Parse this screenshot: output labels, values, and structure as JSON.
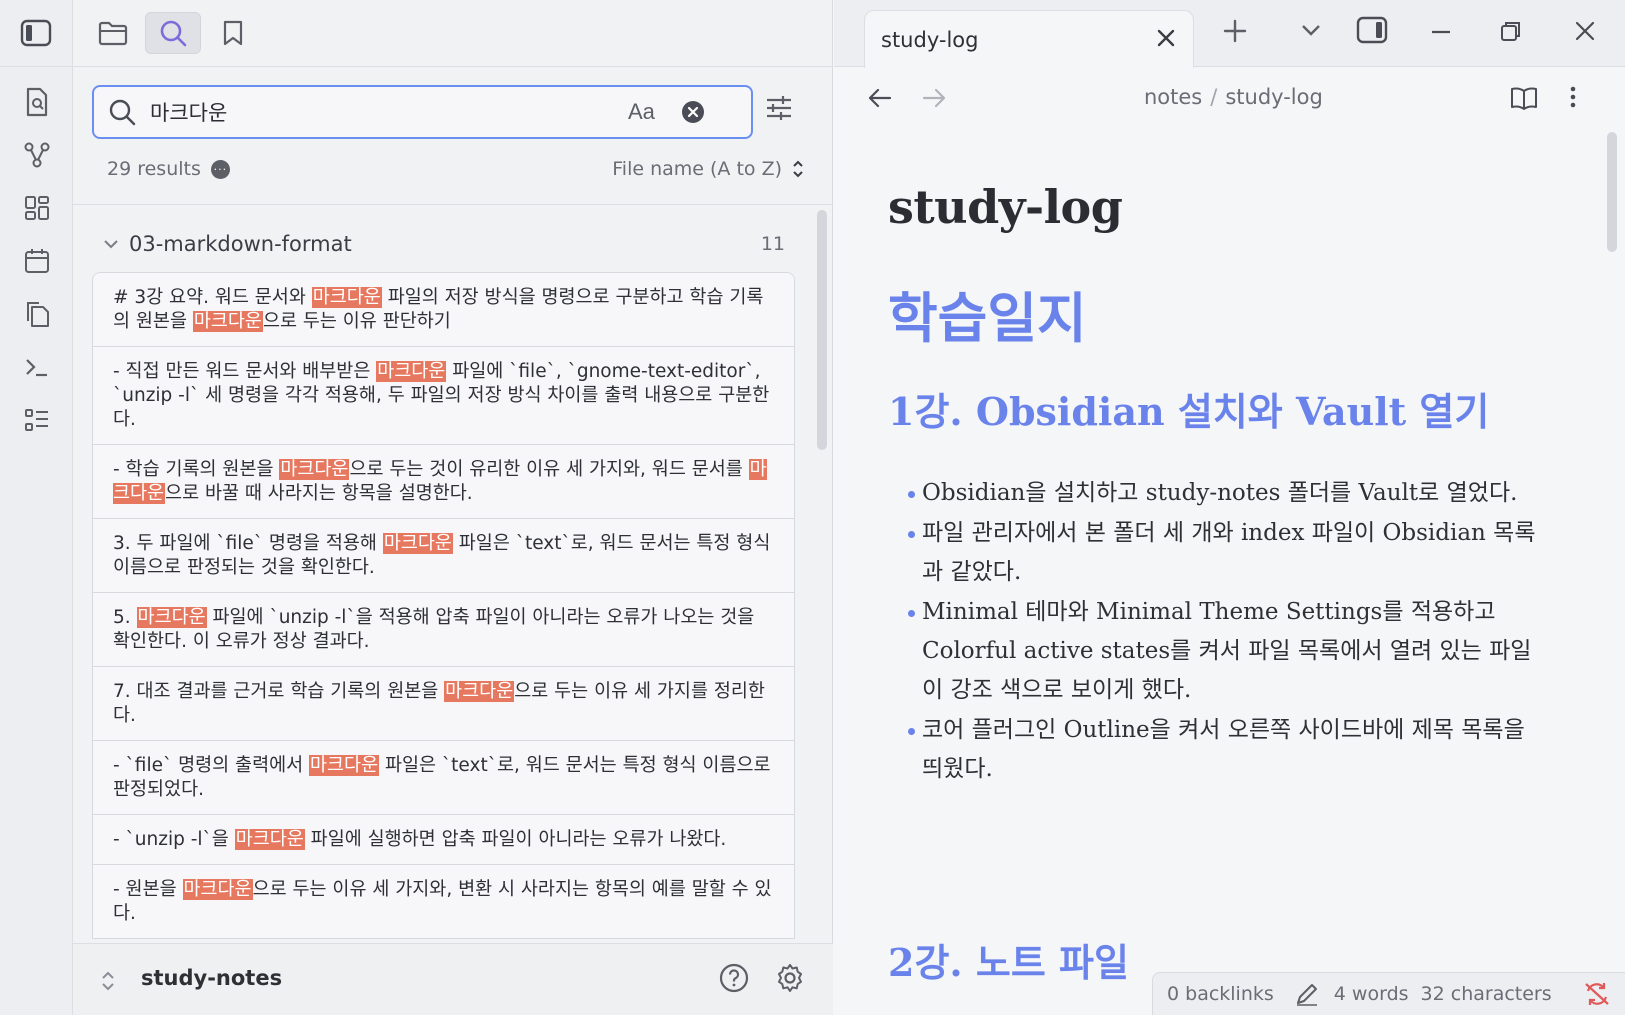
{
  "search": {
    "query": "마크다운",
    "case_label": "Aa",
    "results_count": "29 results",
    "sort_label": "File name (A to Z)"
  },
  "group": {
    "name": "03-markdown-format",
    "count": "11"
  },
  "results": [
    {
      "parts": [
        "# 3강 요약. 워드 문서와 ",
        {
          "hl": "마크다운"
        },
        " 파일의 저장 방식을 명령으로 구분하고 학습 기록의 원본을 ",
        {
          "hl": "마크다운"
        },
        "으로 두는 이유 판단하기"
      ]
    },
    {
      "parts": [
        "- 직접 만든 워드 문서와 배부받은 ",
        {
          "hl": "마크다운"
        },
        " 파일에 `file`, `gnome-text-editor`, `unzip -l` 세 명령을 각각 적용해, 두 파일의 저장 방식 차이를 출력 내용으로 구분한다."
      ]
    },
    {
      "parts": [
        "- 학습 기록의 원본을 ",
        {
          "hl": "마크다운"
        },
        "으로 두는 것이 유리한 이유 세 가지와, 워드 문서를 ",
        {
          "hl": "마크다운"
        },
        "으로 바꿀 때 사라지는 항목을 설명한다."
      ]
    },
    {
      "parts": [
        "3. 두 파일에 `file` 명령을 적용해 ",
        {
          "hl": "마크다운"
        },
        " 파일은 `text`로, 워드 문서는 특정 형식 이름으로 판정되는 것을 확인한다."
      ]
    },
    {
      "parts": [
        "5. ",
        {
          "hl": "마크다운"
        },
        " 파일에 `unzip -l`을 적용해 압축 파일이 아니라는 오류가 나오는 것을 확인한다. 이 오류가 정상 결과다."
      ]
    },
    {
      "parts": [
        "7. 대조 결과를 근거로 학습 기록의 원본을 ",
        {
          "hl": "마크다운"
        },
        "으로 두는 이유 세 가지를 정리한다."
      ]
    },
    {
      "parts": [
        "- `file` 명령의 출력에서 ",
        {
          "hl": "마크다운"
        },
        " 파일은 `text`로, 워드 문서는 특정 형식 이름으로 판정되었다."
      ]
    },
    {
      "parts": [
        "- `unzip -l`을 ",
        {
          "hl": "마크다운"
        },
        " 파일에 실행하면 압축 파일이 아니라는 오류가 나왔다."
      ]
    },
    {
      "parts": [
        "- 원본을 ",
        {
          "hl": "마크다운"
        },
        "으로 두는 이유 세 가지와, 변환 시 사라지는 항목의 예를 말할 수 있다."
      ]
    }
  ],
  "vault": {
    "name": "study-notes"
  },
  "tab": {
    "title": "study-log"
  },
  "breadcrumb": {
    "folder": "notes",
    "sep": "/",
    "file": "study-log"
  },
  "doc": {
    "title": "study-log",
    "h1": "학습일지",
    "h2": "1강. Obsidian 설치와 Vault 열기",
    "bullets": [
      "Obsidian을 설치하고 study-notes 폴더를 Vault로 열었다.",
      "파일 관리자에서 본 폴더 세 개와 index 파일이 Obsidian 목록과 같았다.",
      "Minimal 테마와 Minimal Theme Settings를 적용하고 Colorful active states를 켜서 파일 목록에서 열려 있는 파일이 강조 색으로 보이게 했다.",
      "코어 플러그인 Outline을 켜서 오른쪽 사이드바에 제목 목록을 띄웠다."
    ],
    "h2_next": "2강. 노트 파일"
  },
  "status": {
    "backlinks": "0 backlinks",
    "words": "4 words",
    "chars": "32 characters"
  },
  "colors": {
    "accent": "#6a83ea",
    "highlight": "#e6785f",
    "search_border": "#6b8ff0"
  }
}
